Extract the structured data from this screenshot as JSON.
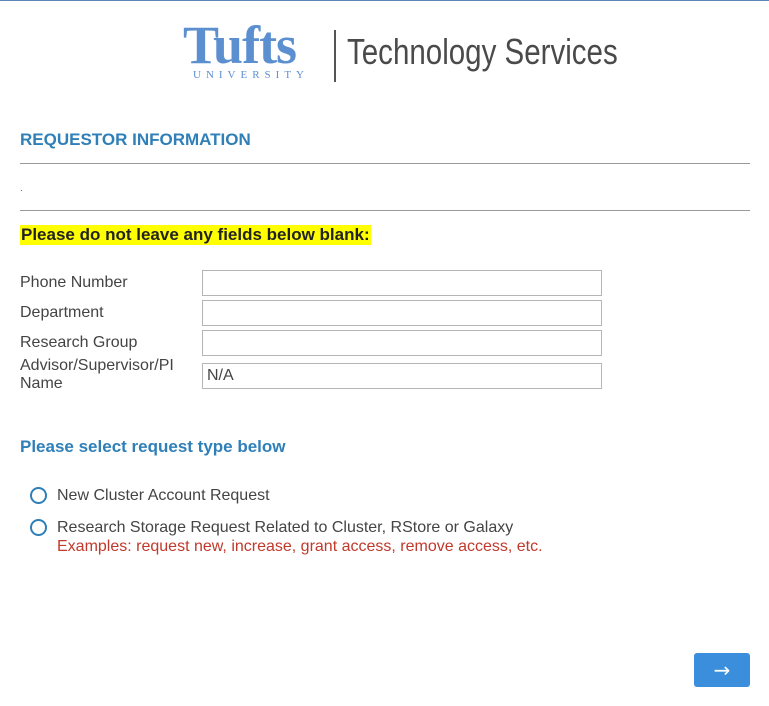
{
  "header": {
    "logo_name": "Tufts",
    "logo_subtitle": "UNIVERSITY",
    "logo_service": "Technology Services",
    "brand_color": "#5b8fd0"
  },
  "requestor": {
    "section_title": "REQUESTOR INFORMATION",
    "separator_text": ".",
    "warning": "Please do not leave any fields below blank:",
    "fields": [
      {
        "label": "Phone Number",
        "value": ""
      },
      {
        "label": "Department",
        "value": ""
      },
      {
        "label": "Research Group",
        "value": ""
      },
      {
        "label": "Advisor/Supervisor/PI Name",
        "value": "N/A"
      }
    ]
  },
  "request_type": {
    "title": "Please select request type below",
    "options": [
      {
        "label": "New Cluster Account Request",
        "selected": false
      },
      {
        "label": "Research Storage Request Related to Cluster, RStore or Galaxy",
        "note": "Examples: request new, increase, grant access, remove access, etc.",
        "selected": false
      }
    ]
  },
  "navigation": {
    "next_label": "→",
    "button_color": "#3b8edb"
  },
  "colors": {
    "accent": "#2f7fb8",
    "warning_highlight": "#ffff00",
    "note_red": "#c0392b"
  }
}
